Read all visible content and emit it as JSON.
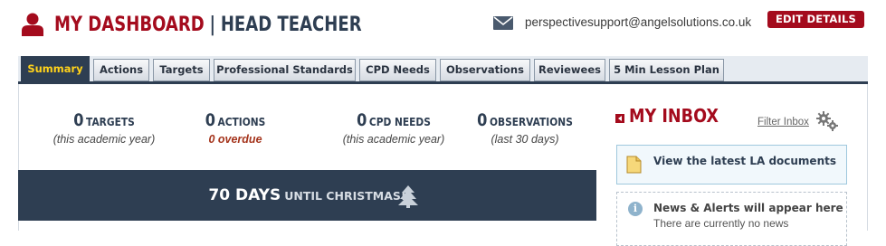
{
  "header": {
    "title": "MY DASHBOARD",
    "separator": "|",
    "role": "HEAD TEACHER",
    "email": "perspectivesupport@angelsolutions.co.uk",
    "edit_button": "EDIT DETAILS"
  },
  "tabs": [
    {
      "label": "Summary",
      "active": true
    },
    {
      "label": "Actions",
      "active": false
    },
    {
      "label": "Targets",
      "active": false
    },
    {
      "label": "Professional Standards",
      "active": false
    },
    {
      "label": "CPD Needs",
      "active": false
    },
    {
      "label": "Observations",
      "active": false
    },
    {
      "label": "Reviewees",
      "active": false
    },
    {
      "label": "5 Min Lesson Plan",
      "active": false
    }
  ],
  "stats": [
    {
      "value": "0",
      "label": "TARGETS",
      "sub": "(this academic year)"
    },
    {
      "value": "0",
      "label": "ACTIONS",
      "sub": "0 overdue"
    },
    {
      "value": "0",
      "label": "CPD NEEDS",
      "sub": "(this academic year)"
    },
    {
      "value": "0",
      "label": "OBSERVATIONS",
      "sub": "(last 30 days)"
    }
  ],
  "countdown": {
    "days": "70 DAYS",
    "label": "UNTIL CHRISTMAS!"
  },
  "inbox": {
    "title": "MY INBOX",
    "filter_link": "Filter Inbox",
    "la_documents": "View the latest LA documents",
    "news_title": "News & Alerts will appear here",
    "news_sub": "There are currently no news"
  },
  "colors": {
    "brand_red": "#a40b1d",
    "navy": "#2e3e52",
    "active_tab_text": "#ffd21a",
    "overdue": "#a4331b"
  },
  "icons": {
    "user": "user-icon",
    "mail": "mail-icon",
    "tree": "tree-icon",
    "inbox": "inbox-collapse-icon",
    "settings": "gears-icon",
    "document": "document-icon",
    "info": "info-icon"
  }
}
